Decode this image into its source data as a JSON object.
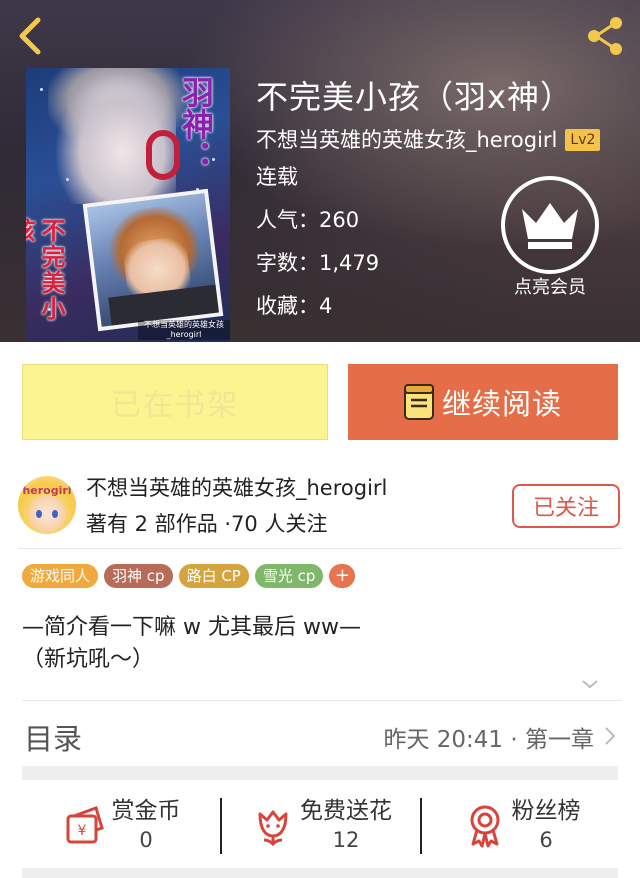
{
  "header": {
    "back_icon": "chevron-left-icon",
    "share_icon": "share-icon"
  },
  "cover": {
    "vertical_title": "不完美小孩",
    "vertical_subtitle": "羽神：",
    "small_text": "不想当英雄的英雄女孩_herogirl"
  },
  "book": {
    "title": "不完美小孩（羽x神）",
    "author": "不想当英雄的英雄女孩_herogirl",
    "author_level": "Lv2",
    "status": "连载",
    "popularity_label": "人气：",
    "popularity": "260",
    "word_count_label": "字数：",
    "word_count": "1,479",
    "favorites_label": "收藏：",
    "favorites": "4"
  },
  "vip": {
    "label": "点亮会员",
    "icon": "crown-icon"
  },
  "actions": {
    "on_shelf": "已在书架",
    "continue_reading": "继续阅读"
  },
  "author_card": {
    "avatar_text": "herogirl",
    "name": "不想当英雄的英雄女孩_herogirl",
    "stats": "著有 2 部作品 ·70 人关注",
    "follow_button": "已关注"
  },
  "tags": [
    {
      "label": "游戏同人",
      "color": "#f0a93c"
    },
    {
      "label": "羽神 cp",
      "color": "#b96b5a"
    },
    {
      "label": "路白 CP",
      "color": "#d6a43e"
    },
    {
      "label": "雪光 cp",
      "color": "#7fb86a"
    },
    {
      "label": "+",
      "color": "#e8734f"
    }
  ],
  "intro": {
    "line1": "—简介看一下嘛 w 尤其最后 ww—",
    "line2": "（新坑吼～）"
  },
  "catalog": {
    "title": "目录",
    "latest": "昨天 20:41 · 第一章"
  },
  "stats": [
    {
      "label": "赏金币",
      "value": "0",
      "icon": "coin-envelope-icon"
    },
    {
      "label": "免费送花",
      "value": "12",
      "icon": "flower-icon"
    },
    {
      "label": "粉丝榜",
      "value": "6",
      "icon": "medal-icon"
    }
  ],
  "colors": {
    "accent": "#e56d47",
    "shelf_bg": "#fbf491",
    "follow": "#e0574a"
  }
}
